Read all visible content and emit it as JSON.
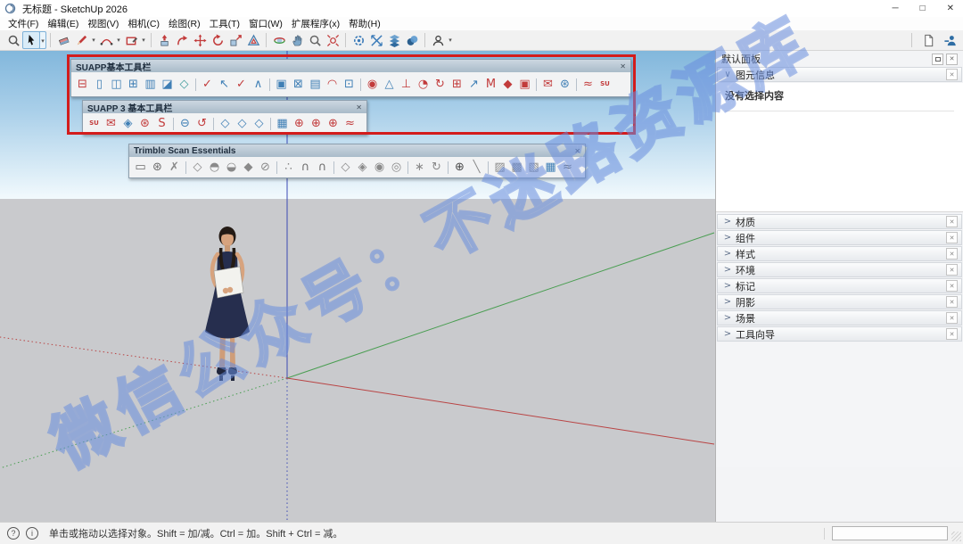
{
  "window": {
    "title": "无标题 - SketchUp 2026",
    "minimize_glyph": "─",
    "maximize_glyph": "□",
    "close_glyph": "✕"
  },
  "menu": {
    "items": [
      "文件(F)",
      "编辑(E)",
      "视图(V)",
      "相机(C)",
      "绘图(R)",
      "工具(T)",
      "窗口(W)",
      "扩展程序(x)",
      "帮助(H)"
    ]
  },
  "main_toolbar": {
    "items": [
      {
        "name": "search",
        "icon": "search"
      },
      {
        "name": "select",
        "icon": "select",
        "pressed": true,
        "caret": true
      },
      {
        "sep": true
      },
      {
        "name": "eraser",
        "icon": "eraser"
      },
      {
        "name": "line",
        "icon": "pencil",
        "caret": true
      },
      {
        "name": "arc",
        "icon": "arc",
        "caret": true
      },
      {
        "name": "rectangle",
        "icon": "rectangle",
        "caret": true
      },
      {
        "sep": true
      },
      {
        "name": "push-pull",
        "icon": "pushpull"
      },
      {
        "name": "follow-me",
        "icon": "followme"
      },
      {
        "name": "move",
        "icon": "move"
      },
      {
        "name": "rotate",
        "icon": "rotate"
      },
      {
        "name": "scale",
        "icon": "scale"
      },
      {
        "name": "offset",
        "icon": "offset"
      },
      {
        "sep": true
      },
      {
        "name": "orbit",
        "icon": "orbit"
      },
      {
        "name": "pan",
        "icon": "pan"
      },
      {
        "name": "zoom",
        "icon": "zoom"
      },
      {
        "name": "zoom-extents",
        "icon": "zoomext"
      },
      {
        "sep": true
      },
      {
        "name": "extension-1",
        "icon": "exta"
      },
      {
        "name": "extension-2",
        "icon": "extb"
      },
      {
        "name": "extension-3",
        "icon": "extc"
      },
      {
        "name": "extension-4",
        "icon": "extd"
      },
      {
        "sep": true
      },
      {
        "name": "account",
        "icon": "account",
        "caret": true
      }
    ],
    "right_items": [
      {
        "name": "new-document",
        "icon": "doc"
      },
      {
        "name": "share-model",
        "icon": "personblue"
      }
    ]
  },
  "floating_toolbars": [
    {
      "title": "SUAPP基本工具栏",
      "close_glyph": "✕",
      "icons": [
        {
          "g": "⊟",
          "c": "#c23b3b"
        },
        {
          "g": "▯",
          "c": "#3f7fb5"
        },
        {
          "g": "◫",
          "c": "#3f7fb5"
        },
        {
          "g": "⊞",
          "c": "#3f7fb5"
        },
        {
          "g": "▥",
          "c": "#3f7fb5"
        },
        {
          "g": "◪",
          "c": "#3f7fb5"
        },
        {
          "g": "◇",
          "c": "#3f9b9b"
        },
        {
          "sep": true
        },
        {
          "g": "✓",
          "c": "#c23b3b"
        },
        {
          "g": "↖",
          "c": "#3f7fb5"
        },
        {
          "g": "✓",
          "c": "#c23b3b"
        },
        {
          "g": "∧",
          "c": "#3f7fb5"
        },
        {
          "sep": true
        },
        {
          "g": "▣",
          "c": "#3f7fb5"
        },
        {
          "g": "⊠",
          "c": "#3f7fb5"
        },
        {
          "g": "▤",
          "c": "#3f7fb5"
        },
        {
          "g": "◠",
          "c": "#c23b3b"
        },
        {
          "g": "⊡",
          "c": "#3f7fb5"
        },
        {
          "sep": true
        },
        {
          "g": "◉",
          "c": "#c23b3b"
        },
        {
          "g": "△",
          "c": "#3f7fb5"
        },
        {
          "g": "⊥",
          "c": "#c23b3b"
        },
        {
          "g": "◔",
          "c": "#c23b3b"
        },
        {
          "g": "↻",
          "c": "#c23b3b"
        },
        {
          "g": "⊞",
          "c": "#c23b3b"
        },
        {
          "g": "↗",
          "c": "#3f7fb5"
        },
        {
          "g": "M",
          "c": "#c23b3b"
        },
        {
          "g": "◆",
          "c": "#c23b3b"
        },
        {
          "g": "▣",
          "c": "#c23b3b"
        },
        {
          "sep": true
        },
        {
          "g": "✉",
          "c": "#c23b3b"
        },
        {
          "g": "⊛",
          "c": "#3f7fb5"
        },
        {
          "sep": true
        },
        {
          "g": "≈",
          "c": "#c23b3b"
        },
        {
          "g": "SU",
          "c": "#c23b3b",
          "t": 1
        }
      ]
    },
    {
      "title": "SUAPP 3 基本工具栏",
      "close_glyph": "✕",
      "icons": [
        {
          "g": "SU",
          "c": "#c23b3b",
          "t": 1
        },
        {
          "g": "✉",
          "c": "#c23b3b"
        },
        {
          "g": "◈",
          "c": "#3f7fb5"
        },
        {
          "g": "⊛",
          "c": "#c23b3b"
        },
        {
          "g": "S",
          "c": "#c23b3b"
        },
        {
          "sep": true
        },
        {
          "g": "⊖",
          "c": "#3f7fb5"
        },
        {
          "g": "↺",
          "c": "#c23b3b"
        },
        {
          "sep": true
        },
        {
          "g": "◇",
          "c": "#3f7fb5"
        },
        {
          "g": "◇",
          "c": "#3f7fb5"
        },
        {
          "g": "◇",
          "c": "#3f7fb5"
        },
        {
          "sep": true
        },
        {
          "g": "▦",
          "c": "#3f7fb5"
        },
        {
          "g": "⊕",
          "c": "#c23b3b"
        },
        {
          "g": "⊕",
          "c": "#c23b3b"
        },
        {
          "g": "⊕",
          "c": "#c23b3b"
        },
        {
          "g": "≈",
          "c": "#c23b3b"
        }
      ]
    },
    {
      "title": "Trimble Scan Essentials",
      "close_glyph": "✕",
      "icons": [
        {
          "g": "▭",
          "c": "#6b6b6b"
        },
        {
          "g": "⊛",
          "c": "#6b6b6b"
        },
        {
          "g": "✗",
          "c": "#8a8a8a"
        },
        {
          "sep": true
        },
        {
          "g": "◇",
          "c": "#8a8a8a"
        },
        {
          "g": "◓",
          "c": "#8a8a8a"
        },
        {
          "g": "◒",
          "c": "#8a8a8a"
        },
        {
          "g": "◆",
          "c": "#8a8a8a"
        },
        {
          "g": "⊘",
          "c": "#8a8a8a"
        },
        {
          "sep": true
        },
        {
          "g": "∴",
          "c": "#8a8a8a"
        },
        {
          "g": "∩",
          "c": "#6b6b6b"
        },
        {
          "g": "∩",
          "c": "#6b6b6b"
        },
        {
          "sep": true
        },
        {
          "g": "◇",
          "c": "#8a8a8a"
        },
        {
          "g": "◈",
          "c": "#8a8a8a"
        },
        {
          "g": "◉",
          "c": "#8a8a8a"
        },
        {
          "g": "◎",
          "c": "#8a8a8a"
        },
        {
          "sep": true
        },
        {
          "g": "∗",
          "c": "#8a8a8a"
        },
        {
          "g": "↻",
          "c": "#8a8a8a"
        },
        {
          "sep": true
        },
        {
          "g": "⊕",
          "c": "#4a4a4a"
        },
        {
          "g": "╲",
          "c": "#8a8a8a"
        },
        {
          "sep": true
        },
        {
          "g": "▨",
          "c": "#8a8a8a"
        },
        {
          "g": "▩",
          "c": "#8a8a8a"
        },
        {
          "g": "▧",
          "c": "#8a8a8a"
        },
        {
          "g": "▦",
          "c": "#3f7fb5"
        },
        {
          "g": "≈",
          "c": "#6b6b6b"
        }
      ]
    }
  ],
  "panel": {
    "title": "默认面板",
    "close_glyph": "✕",
    "expanded_section": {
      "label": "图元信息",
      "chevron": "∨",
      "close_glyph": "✕",
      "empty_text": "没有选择内容"
    },
    "chevron_collapsed": ">",
    "collapsed_close_glyph": "✕",
    "collapsed_sections": [
      {
        "label": "材质"
      },
      {
        "label": "组件"
      },
      {
        "label": "样式"
      },
      {
        "label": "环境"
      },
      {
        "label": "标记"
      },
      {
        "label": "阴影"
      },
      {
        "label": "场景"
      },
      {
        "label": "工具向导"
      }
    ]
  },
  "statusbar": {
    "icons": [
      {
        "name": "geolocation-icon",
        "g": "?"
      },
      {
        "name": "info-icon",
        "g": "i"
      }
    ],
    "hint": "单击或拖动以选择对象。Shift = 加/减。Ctrl = 加。Shift + Ctrl = 减。",
    "measurement_value": ""
  },
  "watermark": {
    "text": "微信公众号：不迷路资源库"
  },
  "colors": {
    "axis_red": "#b94444",
    "axis_green": "#4a9e52",
    "axis_blue": "#3b49b4",
    "annotation": "#d31c1c",
    "suapp_red": "#c23b3b",
    "suapp_blue": "#3f7fb5"
  }
}
